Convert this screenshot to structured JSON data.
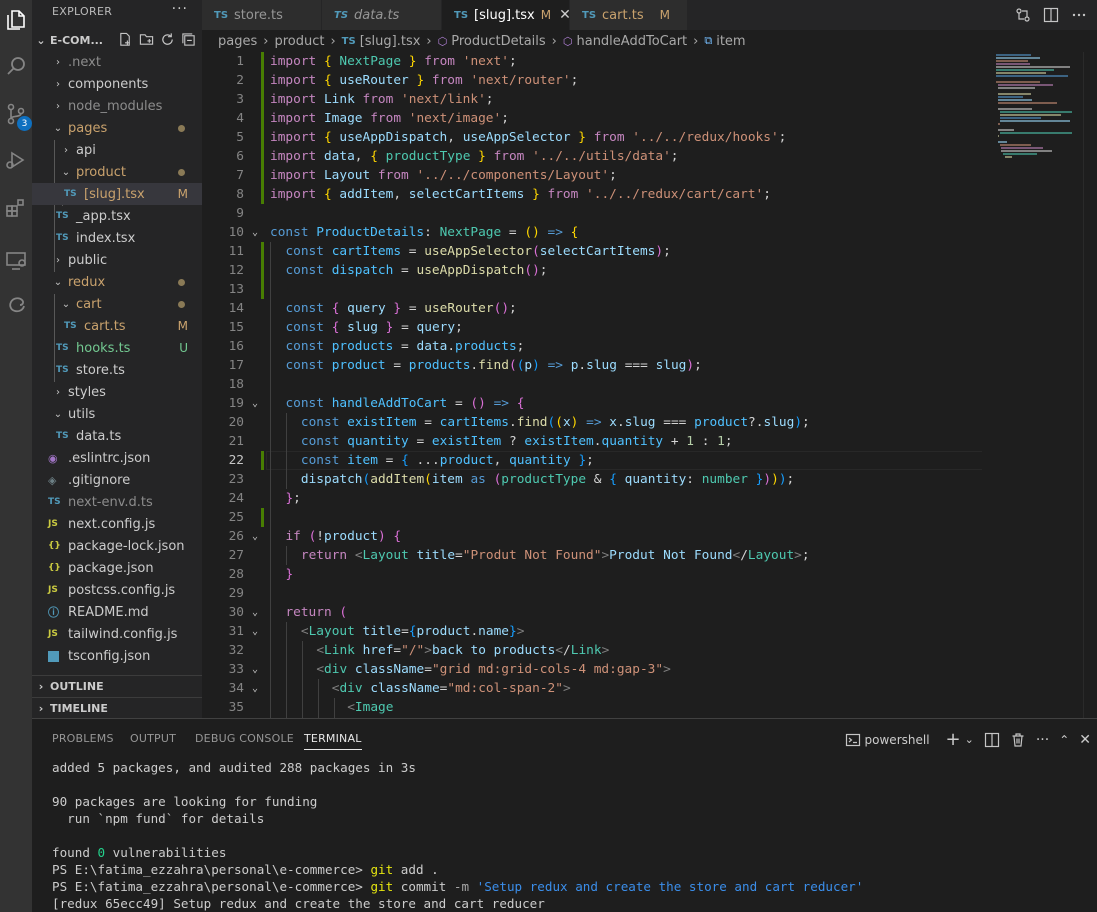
{
  "explorer": {
    "title": "EXPLORER",
    "more": "···",
    "root": "E-COM...",
    "items": [
      {
        "label": ".next",
        "status": "",
        "color": "#8c8c8c"
      },
      {
        "label": "components",
        "status": "",
        "color": "#cccccc"
      },
      {
        "label": "node_modules",
        "status": "",
        "color": "#8c8c8c"
      },
      {
        "label": "pages",
        "status": "",
        "color": "#c9a26d"
      },
      {
        "label": "api",
        "status": "",
        "color": "#cccccc"
      },
      {
        "label": "product",
        "status": "",
        "color": "#c9a26d"
      },
      {
        "label": "[slug].tsx",
        "status": "M",
        "color": "#c9a26d"
      },
      {
        "label": "_app.tsx",
        "status": "",
        "color": "#cccccc"
      },
      {
        "label": "index.tsx",
        "status": "",
        "color": "#cccccc"
      },
      {
        "label": "public",
        "status": "",
        "color": "#cccccc"
      },
      {
        "label": "redux",
        "status": "",
        "color": "#c9a26d"
      },
      {
        "label": "cart",
        "status": "",
        "color": "#c9a26d"
      },
      {
        "label": "cart.ts",
        "status": "M",
        "color": "#c9a26d"
      },
      {
        "label": "hooks.ts",
        "status": "U",
        "color": "#73c991"
      },
      {
        "label": "store.ts",
        "status": "",
        "color": "#cccccc"
      },
      {
        "label": "styles",
        "status": "",
        "color": "#cccccc"
      },
      {
        "label": "utils",
        "status": "",
        "color": "#cccccc"
      },
      {
        "label": "data.ts",
        "status": "",
        "color": "#cccccc"
      },
      {
        "label": ".eslintrc.json",
        "status": "",
        "color": "#cccccc"
      },
      {
        "label": ".gitignore",
        "status": "",
        "color": "#cccccc"
      },
      {
        "label": "next-env.d.ts",
        "status": "",
        "color": "#8c8c8c"
      },
      {
        "label": "next.config.js",
        "status": "",
        "color": "#cccccc"
      },
      {
        "label": "package-lock.json",
        "status": "",
        "color": "#cccccc"
      },
      {
        "label": "package.json",
        "status": "",
        "color": "#cccccc"
      },
      {
        "label": "postcss.config.js",
        "status": "",
        "color": "#cccccc"
      },
      {
        "label": "README.md",
        "status": "",
        "color": "#cccccc"
      },
      {
        "label": "tailwind.config.js",
        "status": "",
        "color": "#cccccc"
      },
      {
        "label": "tsconfig.json",
        "status": "",
        "color": "#cccccc"
      }
    ],
    "file_icons": {
      "ts": "TS",
      "js": "JS",
      "json": "{}"
    },
    "outline": "OUTLINE",
    "timeline": "TIMELINE",
    "scm_badge": "3"
  },
  "tabs": [
    {
      "label": "store.ts",
      "modified": "",
      "icon": "TS"
    },
    {
      "label": "data.ts",
      "modified": "",
      "icon": "TS"
    },
    {
      "label": "[slug].tsx",
      "modified": "M",
      "icon": "TS"
    },
    {
      "label": "cart.ts",
      "modified": "M",
      "icon": "TS"
    }
  ],
  "breadcrumb": {
    "parts": [
      "pages",
      "product",
      "[slug].tsx",
      "ProductDetails",
      "handleAddToCart",
      "item"
    ]
  },
  "code": {
    "current_line": 22,
    "lines": [
      "import { NextPage } from 'next';",
      "import { useRouter } from 'next/router';",
      "import Link from 'next/link';",
      "import Image from 'next/image';",
      "import { useAppDispatch, useAppSelector } from '../../redux/hooks';",
      "import data, { productType } from '../../utils/data';",
      "import Layout from '../../components/Layout';",
      "import { addItem, selectCartItems } from '../../redux/cart/cart';",
      "",
      "const ProductDetails: NextPage = () => {",
      "  const cartItems = useAppSelector(selectCartItems);",
      "  const dispatch = useAppDispatch();",
      "",
      "  const { query } = useRouter();",
      "  const { slug } = query;",
      "  const products = data.products;",
      "  const product = products.find((p) => p.slug === slug);",
      "",
      "  const handleAddToCart = () => {",
      "    const existItem = cartItems.find((x) => x.slug === product?.slug);",
      "    const quantity = existItem ? existItem.quantity + 1 : 1;",
      "    const item = { ...product, quantity };",
      "    dispatch(addItem(item as (productType & { quantity: number })));",
      "  };",
      "",
      "  if (!product) {",
      "    return <Layout title=\"Produt Not Found\">Produt Not Found</Layout>;",
      "  }",
      "",
      "  return (",
      "    <Layout title={product.name}>",
      "      <Link href=\"/\">back to products</Link>",
      "      <div className=\"grid md:grid-cols-4 md:gap-3\">",
      "        <div className=\"md:col-span-2\">",
      "          <Image"
    ]
  },
  "panel": {
    "tabs": [
      "PROBLEMS",
      "OUTPUT",
      "DEBUG CONSOLE",
      "TERMINAL"
    ],
    "active_tab": "TERMINAL",
    "shell": "powershell",
    "terminal": {
      "added": "added 5 packages, and audited 288 packages in 3s",
      "funding1": "90 packages are looking for funding",
      "funding2": "  run `npm fund` for details",
      "found_pre": "found ",
      "found_num": "0",
      "found_post": " vulnerabilities",
      "prompt": "PS E:\\fatima_ezzahra\\personal\\e-commerce> ",
      "cmd1_git": "git",
      "cmd1_rest": " add .",
      "cmd2_git": "git",
      "cmd2_mid": " commit ",
      "cmd2_flag": "-m",
      "cmd2_msg": " 'Setup redux and create the store and cart reducer'",
      "result": "[redux 65ecc49] Setup redux and create the store and cart reducer"
    }
  },
  "colors": {
    "activity_bar": "#333333",
    "sidebar": "#252526",
    "editor": "#1e1e1e",
    "modified": "#c9a26d",
    "untracked": "#73c991",
    "badge": "#0e70c0"
  }
}
